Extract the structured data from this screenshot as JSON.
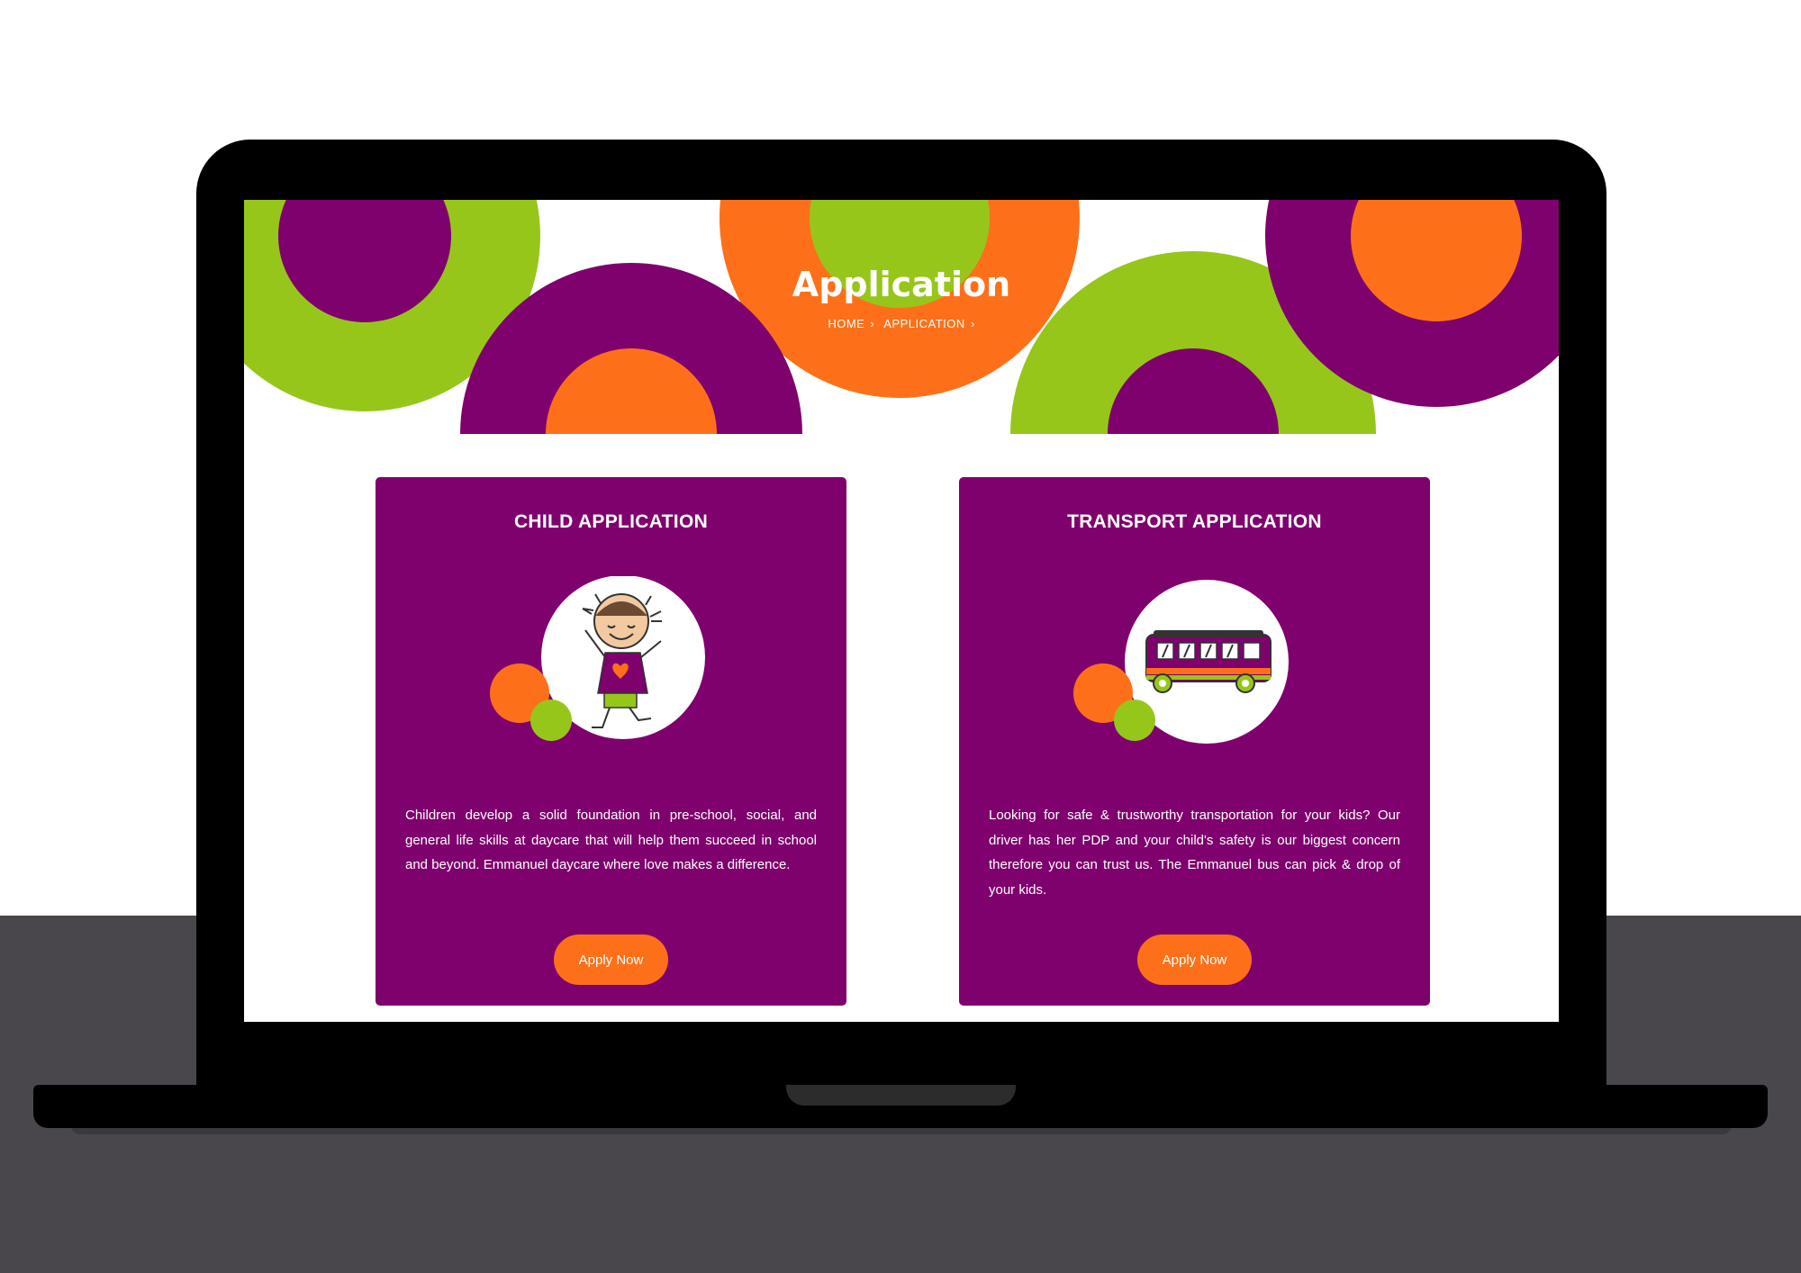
{
  "colors": {
    "purple": "#7f016d",
    "green": "#97c61b",
    "orange": "#fd7019",
    "desk": "#49474c"
  },
  "hero": {
    "title": "Application",
    "breadcrumb": [
      {
        "label": "HOME",
        "separator": "›"
      },
      {
        "label": "APPLICATION",
        "separator": "›"
      }
    ]
  },
  "cards": [
    {
      "title": "CHILD APPLICATION",
      "icon": "child-illustration",
      "text": "Children develop a solid foundation in pre-school, social, and general life skills at daycare that will help them succeed in school and beyond. Emmanuel daycare where love makes a difference.",
      "button": "Apply Now"
    },
    {
      "title": "TRANSPORT APPLICATION",
      "icon": "bus-illustration",
      "text": "Looking for safe & trustworthy transportation for your kids? Our driver has her PDP and your child's safety is our biggest concern therefore you can trust us. The Emmanuel bus can pick & drop of your kids.",
      "button": "Apply Now"
    }
  ]
}
